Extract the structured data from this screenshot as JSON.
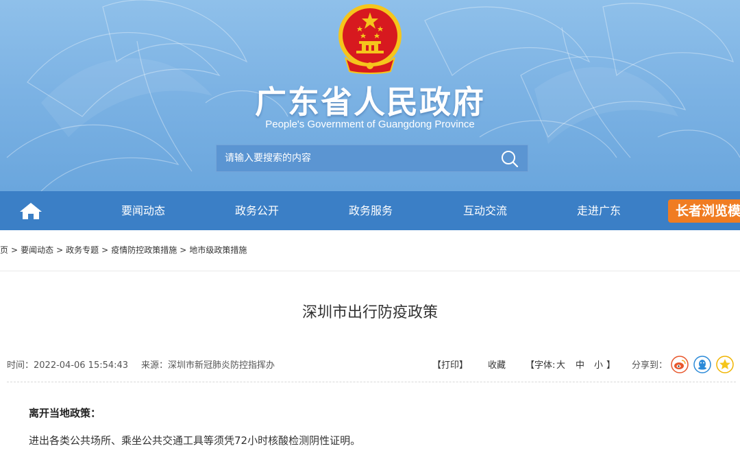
{
  "header": {
    "title": "广东省人民政府",
    "subtitle": "People's Government of Guangdong Province",
    "emblem_icon": "national-emblem-icon"
  },
  "search": {
    "placeholder": "请输入要搜索的内容",
    "icon": "search-icon"
  },
  "nav": {
    "home_icon": "home-icon",
    "items": [
      {
        "label": "要闻动态"
      },
      {
        "label": "政务公开"
      },
      {
        "label": "政务服务"
      },
      {
        "label": "互动交流"
      },
      {
        "label": "走进广东"
      }
    ],
    "elder_mode": "长者浏览模式"
  },
  "breadcrumb": {
    "items": [
      "首页",
      "要闻动态",
      "政务专题",
      "疫情防控政策措施",
      "地市级政策措施"
    ],
    "separator": ">"
  },
  "article": {
    "title": "深圳市出行防疫政策",
    "time": "时间：2022-04-06 15:54:43",
    "source": "来源：深圳市新冠肺炎防控指挥办",
    "tools": {
      "print": "【打印】",
      "collect": "收藏",
      "font_prefix": "【字体:",
      "font_large": "大",
      "font_medium": "中",
      "font_small": "小",
      "font_suffix": "】"
    },
    "share_label": "分享到：",
    "share_icons": [
      "weibo-icon",
      "qq-icon",
      "qzone-icon"
    ],
    "section_heading": "离开当地政策：",
    "paragraph": "进出各类公共场所、乘坐公共交通工具等须凭72小时核酸检测阴性证明。"
  },
  "colors": {
    "banner_top": "#8fc0ea",
    "banner_bottom": "#6aa6dd",
    "nav_bg": "#3b7fc6",
    "search_bg": "#5b95d2",
    "elder_btn": "#f07c22",
    "emblem_red": "#d7191f",
    "emblem_gold": "#f5c51c"
  }
}
